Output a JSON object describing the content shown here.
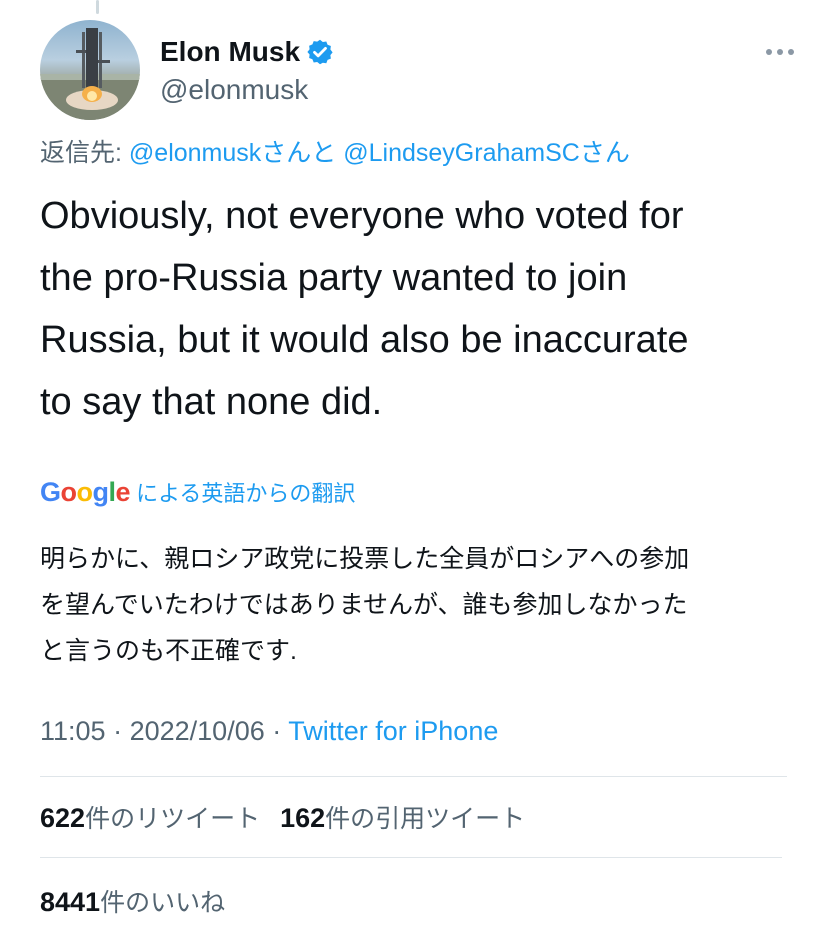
{
  "tweet": {
    "author": {
      "display_name": "Elon Musk",
      "handle": "@elonmusk",
      "verified": true,
      "avatar_icon": "rocket-launch-avatar"
    },
    "more_icon": "more-horizontal-icon",
    "replying_to": {
      "prefix": "返信先:",
      "mention_1": "@elonmusk",
      "connector": "さんと",
      "mention_2": "@LindseyGrahamSC",
      "suffix": "さん"
    },
    "text_lines": [
      "Obviously, not everyone who voted for",
      "the pro-Russia party wanted to join",
      "Russia, but it would also be inaccurate",
      "to say that none did."
    ],
    "translation": {
      "provider": "Google",
      "label": "による英語からの翻訳",
      "lines": [
        "明らかに、親ロシア政党に投票した全員がロシアへの参加",
        "を望んでいたわけではありませんが、誰も参加しなかった",
        "と言うのも不正確です."
      ]
    },
    "meta": {
      "time": "11:05",
      "separator": "·",
      "date": "2022/10/06",
      "source": "Twitter for iPhone"
    },
    "stats": {
      "retweets_count": "622",
      "retweets_label": "件のリツイート",
      "quotes_count": "162",
      "quotes_label": "件の引用ツイート",
      "likes_count": "8441",
      "likes_label": "件のいいね"
    }
  },
  "colors": {
    "accent": "#1d9bf0",
    "text": "#0f1419",
    "secondary": "#536471",
    "divider": "#dfe5e9"
  }
}
